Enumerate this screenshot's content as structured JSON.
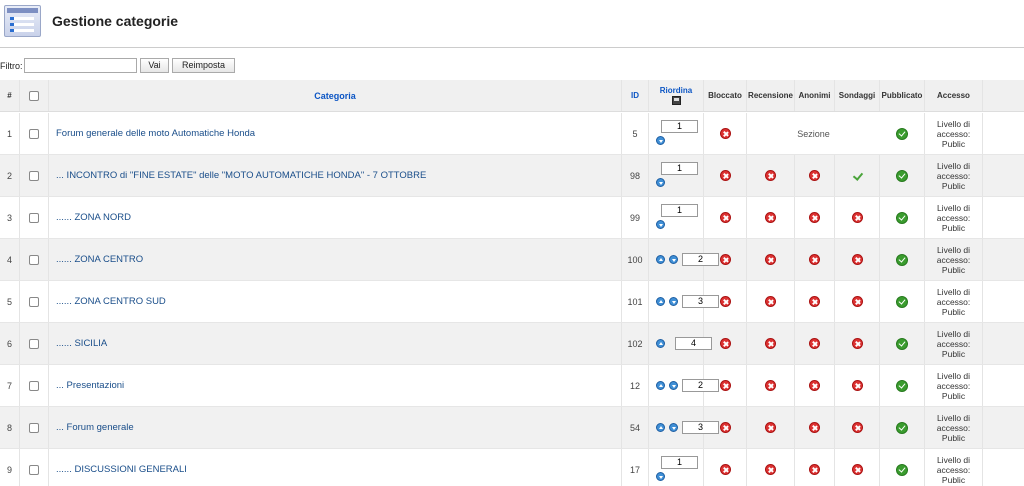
{
  "header": {
    "title": "Gestione categorie",
    "icon": "category-manager-icon"
  },
  "filter": {
    "label": "Filtro:",
    "value": "",
    "go_label": "Vai",
    "reset_label": "Reimposta"
  },
  "columns": {
    "num": "#",
    "category": "Categoria",
    "id": "ID",
    "order": "Riordina",
    "blocked": "Bloccato",
    "review": "Recensione",
    "anonymous": "Anonimi",
    "polls": "Sondaggi",
    "published": "Pubblicato",
    "access": "Accesso"
  },
  "rows": [
    {
      "num": "1",
      "category": "Forum generale delle moto Automatiche Honda",
      "id": "5",
      "order": "1",
      "up": false,
      "down": true,
      "blocked": "x",
      "section": "Sezione",
      "review": null,
      "anonymous": null,
      "polls": null,
      "published": "ok",
      "access": "Livello di accesso: Public"
    },
    {
      "num": "2",
      "category": "... INCONTRO di \"FINE ESTATE\" delle \"MOTO AUTOMATICHE HONDA\" - 7 OTTOBRE",
      "id": "98",
      "order": "1",
      "up": false,
      "down": true,
      "blocked": "x",
      "section": null,
      "review": "x",
      "anonymous": "x",
      "polls": "tick",
      "published": "ok",
      "access": "Livello di accesso: Public"
    },
    {
      "num": "3",
      "category": "...... ZONA NORD",
      "id": "99",
      "order": "1",
      "up": false,
      "down": true,
      "blocked": "x",
      "section": null,
      "review": "x",
      "anonymous": "x",
      "polls": "x",
      "published": "ok",
      "access": "Livello di accesso: Public"
    },
    {
      "num": "4",
      "category": "...... ZONA CENTRO",
      "id": "100",
      "order": "2",
      "up": true,
      "down": true,
      "blocked": "x",
      "section": null,
      "review": "x",
      "anonymous": "x",
      "polls": "x",
      "published": "ok",
      "access": "Livello di accesso: Public"
    },
    {
      "num": "5",
      "category": "...... ZONA CENTRO SUD",
      "id": "101",
      "order": "3",
      "up": true,
      "down": true,
      "blocked": "x",
      "section": null,
      "review": "x",
      "anonymous": "x",
      "polls": "x",
      "published": "ok",
      "access": "Livello di accesso: Public"
    },
    {
      "num": "6",
      "category": "...... SICILIA",
      "id": "102",
      "order": "4",
      "up": true,
      "down": false,
      "blocked": "x",
      "section": null,
      "review": "x",
      "anonymous": "x",
      "polls": "x",
      "published": "ok",
      "access": "Livello di accesso: Public"
    },
    {
      "num": "7",
      "category": "... Presentazioni",
      "id": "12",
      "order": "2",
      "up": true,
      "down": true,
      "blocked": "x",
      "section": null,
      "review": "x",
      "anonymous": "x",
      "polls": "x",
      "published": "ok",
      "access": "Livello di accesso: Public"
    },
    {
      "num": "8",
      "category": "... Forum generale",
      "id": "54",
      "order": "3",
      "up": true,
      "down": true,
      "blocked": "x",
      "section": null,
      "review": "x",
      "anonymous": "x",
      "polls": "x",
      "published": "ok",
      "access": "Livello di accesso: Public"
    },
    {
      "num": "9",
      "category": "...... DISCUSSIONI GENERALI",
      "id": "17",
      "order": "1",
      "up": false,
      "down": true,
      "blocked": "x",
      "section": null,
      "review": "x",
      "anonymous": "x",
      "polls": "x",
      "published": "ok",
      "access": "Livello di accesso: Public"
    }
  ]
}
